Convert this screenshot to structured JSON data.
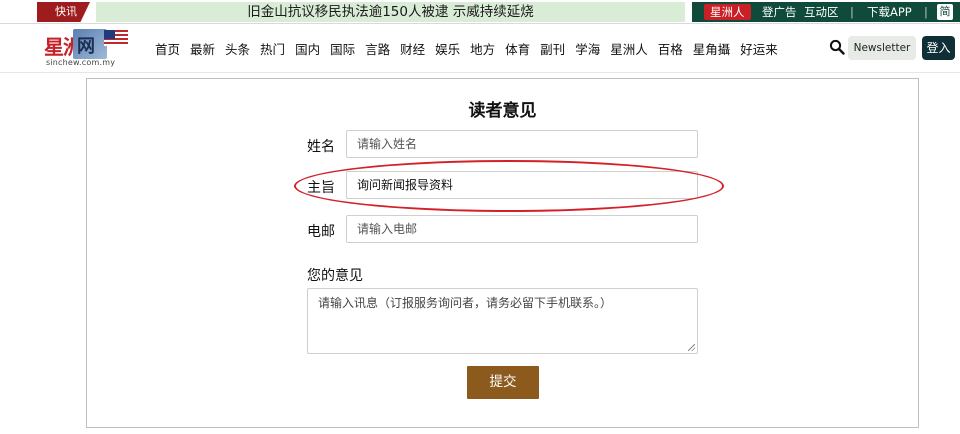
{
  "topbar": {
    "flash_label": "快讯",
    "headline": "旧金山抗议移民执法逾150人被逮 示威持续延烧",
    "brand": "星洲人",
    "advertise": "登广告",
    "interact": "互动区",
    "separator": "|",
    "download": "下载APP",
    "lang": "简"
  },
  "logo": {
    "name_cn": "星洲",
    "net_char": "网",
    "url": "sinchew.com.my"
  },
  "nav": {
    "items": [
      "首页",
      "最新",
      "头条",
      "热门",
      "国内",
      "国际",
      "言路",
      "财经",
      "娱乐",
      "地方",
      "体育",
      "副刊",
      "学海",
      "星洲人",
      "百格",
      "星角攝",
      "好运来"
    ]
  },
  "header": {
    "newsletter": "Newsletter",
    "login": "登入",
    "search_icon": "search-icon"
  },
  "form": {
    "title": "读者意见",
    "name_label": "姓名",
    "name_placeholder": "请输入姓名",
    "subject_label": "主旨",
    "subject_value": "询问新闻报导资料",
    "email_label": "电邮",
    "email_placeholder": "请输入电邮",
    "opinion_label": "您的意见",
    "opinion_placeholder": "请输入讯息（订报服务询问者，请务必留下手机联系。）",
    "submit": "提交"
  },
  "colors": {
    "flash_red": "#9e1b1e",
    "ticker_green": "#d8ecd6",
    "util_green": "#0f4a3a",
    "brand_red": "#c91f26",
    "submit_brown": "#8b5a1c",
    "annotation_red": "#d42027"
  }
}
